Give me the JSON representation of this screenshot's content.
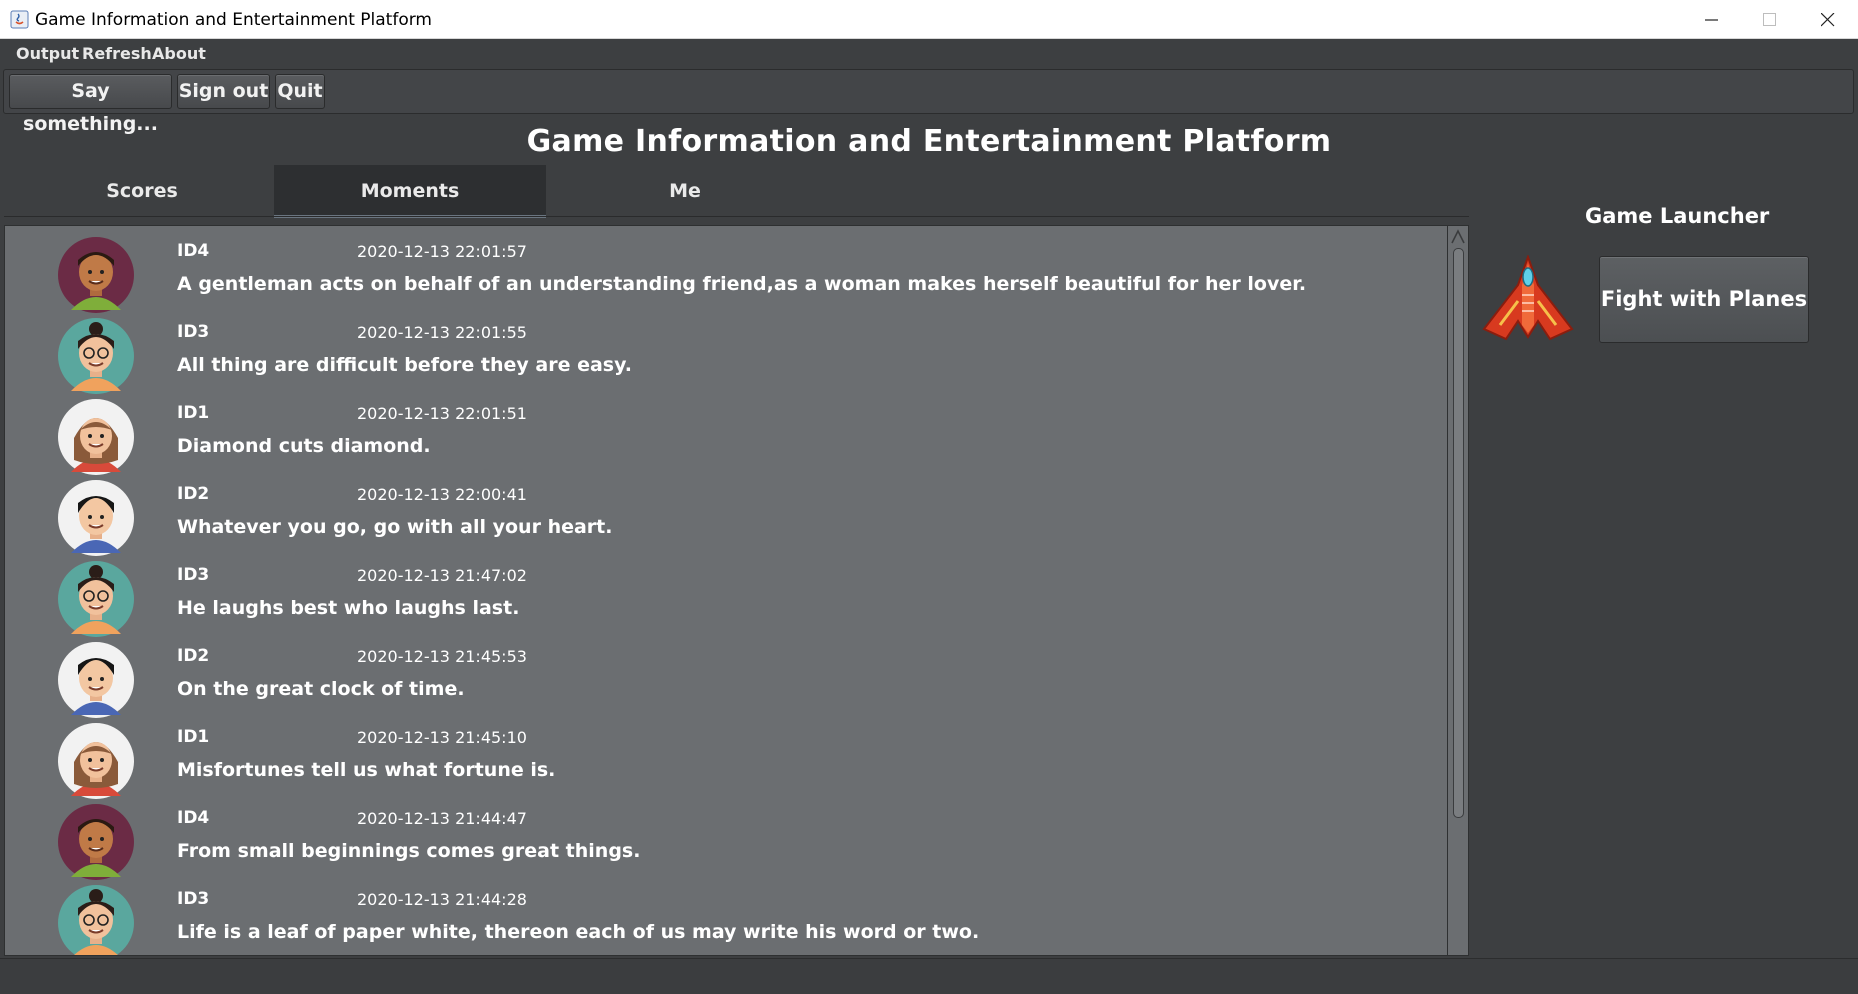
{
  "window": {
    "title": "Game Information and Entertainment Platform",
    "controls": [
      "minimize",
      "maximize",
      "close"
    ]
  },
  "menu": {
    "items": [
      {
        "label": "Output"
      },
      {
        "label": "Refresh"
      },
      {
        "label": "About"
      }
    ]
  },
  "toolbar": {
    "say_label": "Say something...",
    "signout_label": "Sign out",
    "quit_label": "Quit"
  },
  "header": {
    "title": "Game Information and Entertainment Platform"
  },
  "tabs": [
    {
      "label": "Scores",
      "active": false
    },
    {
      "label": "Moments",
      "active": true
    },
    {
      "label": "Me",
      "active": false
    }
  ],
  "posts": [
    {
      "id": "ID4",
      "time": "2020-12-13 22:01:57",
      "text": "A gentleman acts on behalf of an understanding friend,as a woman makes herself beautiful for her lover.",
      "avatar": "man-dark-avatar-icon"
    },
    {
      "id": "ID3",
      "time": "2020-12-13 22:01:55",
      "text": "All thing are difficult before they are easy.",
      "avatar": "woman-glasses-avatar-icon"
    },
    {
      "id": "ID1",
      "time": "2020-12-13 22:01:51",
      "text": "Diamond cuts diamond.",
      "avatar": "woman-brown-hair-avatar-icon"
    },
    {
      "id": "ID2",
      "time": "2020-12-13 22:00:41",
      "text": "Whatever you go, go with all your heart.",
      "avatar": "boy-black-hair-avatar-icon"
    },
    {
      "id": "ID3",
      "time": "2020-12-13 21:47:02",
      "text": "He laughs best who laughs last.",
      "avatar": "woman-glasses-avatar-icon"
    },
    {
      "id": "ID2",
      "time": "2020-12-13 21:45:53",
      "text": "On the great clock of time.",
      "avatar": "boy-black-hair-avatar-icon"
    },
    {
      "id": "ID1",
      "time": "2020-12-13 21:45:10",
      "text": "Misfortunes tell us what fortune is.",
      "avatar": "woman-brown-hair-avatar-icon"
    },
    {
      "id": "ID4",
      "time": "2020-12-13 21:44:47",
      "text": "From small beginnings comes great things.",
      "avatar": "man-dark-avatar-icon"
    },
    {
      "id": "ID3",
      "time": "2020-12-13 21:44:28",
      "text": "Life is a leaf of paper white, thereon each of us may write his word or two.",
      "avatar": "woman-glasses-avatar-icon"
    }
  ],
  "launcher": {
    "title": "Game Launcher",
    "game_label": "Fight with Planes",
    "game_icon": "red-plane-icon"
  },
  "colors": {
    "background": "#3d3f41",
    "feed_background": "#6b6e71",
    "active_tab": "#2d2f31",
    "text": "#ffffff"
  }
}
